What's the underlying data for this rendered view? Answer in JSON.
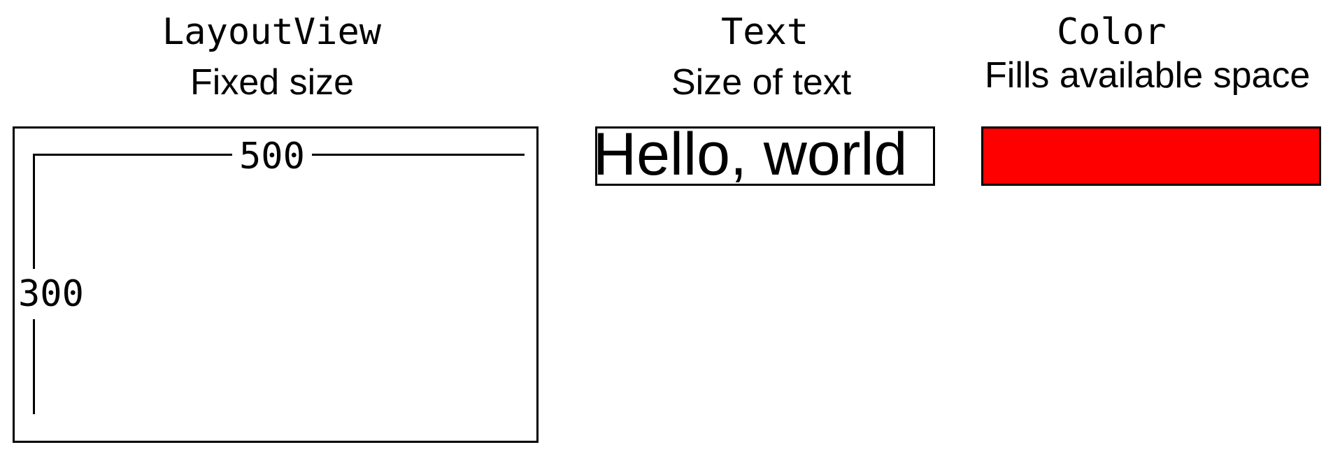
{
  "columns": [
    {
      "title": "LayoutView",
      "subtitle": "Fixed size"
    },
    {
      "title": "Text",
      "subtitle": "Size of text"
    },
    {
      "title": "Color",
      "subtitle": "Fills available space"
    }
  ],
  "layout_view": {
    "width_label": "500",
    "height_label": "300"
  },
  "text_view": {
    "sample_text": "Hello, world"
  },
  "color_view": {
    "fill_color": "#ff0000"
  }
}
